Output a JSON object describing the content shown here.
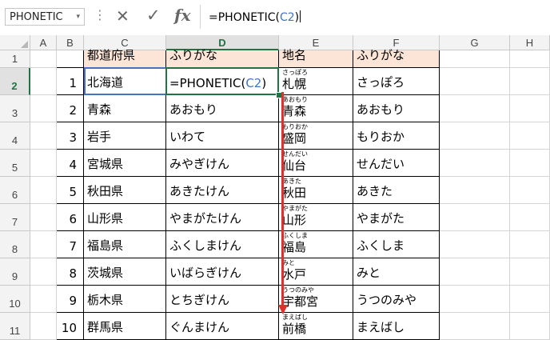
{
  "formula_bar": {
    "name_box": "PHONETIC",
    "name_box_arrow": "▾",
    "dots": "⋮",
    "cancel": "✕",
    "enter": "✓",
    "fx": "fx",
    "formula_prefix": "=PHONETIC(",
    "formula_ref": "C2",
    "formula_suffix": ")"
  },
  "columns": [
    "A",
    "B",
    "C",
    "D",
    "E",
    "F",
    "G",
    "H"
  ],
  "selected_column": "D",
  "rows": [
    "1",
    "2",
    "3",
    "4",
    "5",
    "6",
    "7",
    "8",
    "9",
    "10",
    "11"
  ],
  "selected_row": "2",
  "table": {
    "header": {
      "pref": "都道府県",
      "pref_kana": "ふりがな",
      "place": "地名",
      "place_kana": "ふりがな"
    },
    "editing_cell": {
      "prefix": "=PHONETIC(",
      "ref": "C2",
      "suffix": ")"
    },
    "rows": [
      {
        "no": "1",
        "pref": "北海道",
        "kana": "",
        "place": "札幌",
        "place_furi": "さっぽろ",
        "place_kana": "さっぽろ"
      },
      {
        "no": "2",
        "pref": "青森",
        "kana": "あおもり",
        "place": "青森",
        "place_furi": "あおもり",
        "place_kana": "あおもり"
      },
      {
        "no": "3",
        "pref": "岩手",
        "kana": "いわて",
        "place": "盛岡",
        "place_furi": "もりおか",
        "place_kana": "もりおか"
      },
      {
        "no": "4",
        "pref": "宮城県",
        "kana": "みやぎけん",
        "place": "仙台",
        "place_furi": "せんだい",
        "place_kana": "せんだい"
      },
      {
        "no": "5",
        "pref": "秋田県",
        "kana": "あきたけん",
        "place": "秋田",
        "place_furi": "あきた",
        "place_kana": "あきた"
      },
      {
        "no": "6",
        "pref": "山形県",
        "kana": "やまがたけん",
        "place": "山形",
        "place_furi": "やまがた",
        "place_kana": "やまがた"
      },
      {
        "no": "7",
        "pref": "福島県",
        "kana": "ふくしまけん",
        "place": "福島",
        "place_furi": "ふくしま",
        "place_kana": "ふくしま"
      },
      {
        "no": "8",
        "pref": "茨城県",
        "kana": "いばらぎけん",
        "place": "水戸",
        "place_furi": "みと",
        "place_kana": "みと"
      },
      {
        "no": "9",
        "pref": "栃木県",
        "kana": "とちぎけん",
        "place": "宇都宮",
        "place_furi": "うつのみや",
        "place_kana": "うつのみや"
      },
      {
        "no": "10",
        "pref": "群馬県",
        "kana": "ぐんまけん",
        "place": "前橋",
        "place_furi": "まえばし",
        "place_kana": "まえばし"
      }
    ]
  },
  "colors": {
    "header_fill": "#fce4d6",
    "excel_green": "#217346",
    "selection_blue": "#4472c4",
    "arrow_red": "#e0302d"
  }
}
